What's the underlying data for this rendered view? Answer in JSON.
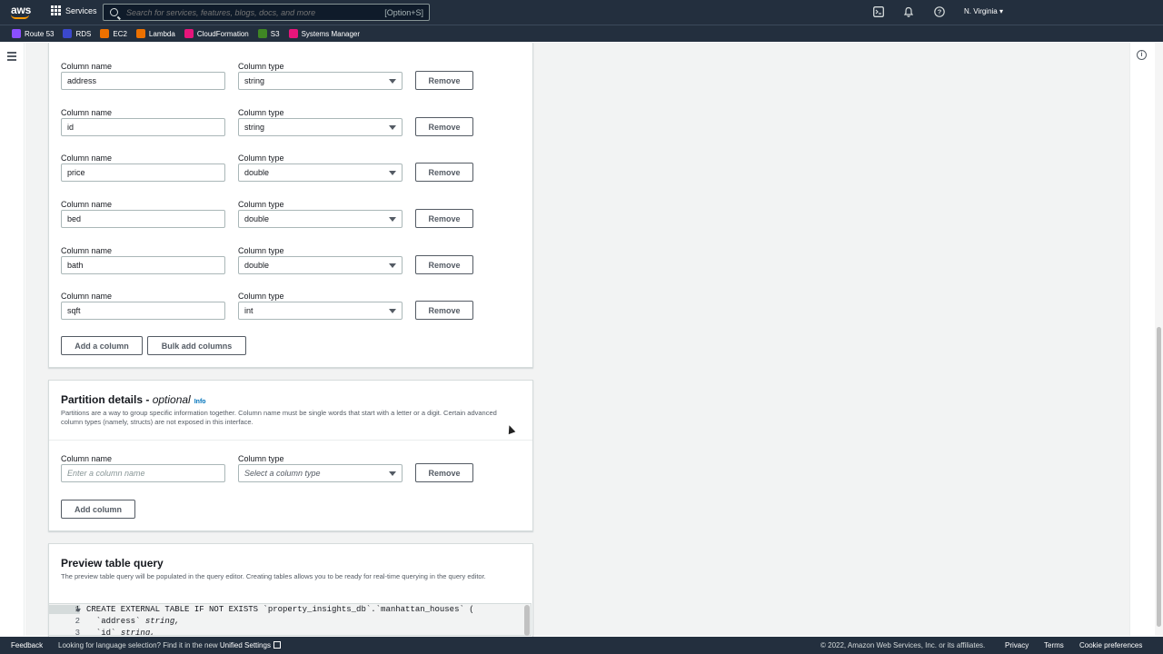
{
  "topnav": {
    "logo_text": "aws",
    "services_label": "Services",
    "search_placeholder": "Search for services, features, blogs, docs, and more",
    "search_shortcut": "[Option+S]",
    "region_label": "N. Virginia ▾"
  },
  "favorites": [
    {
      "label": "Route 53",
      "color": "#8c4fff"
    },
    {
      "label": "RDS",
      "color": "#3b48cc"
    },
    {
      "label": "EC2",
      "color": "#ed7100"
    },
    {
      "label": "Lambda",
      "color": "#ed7100"
    },
    {
      "label": "CloudFormation",
      "color": "#e7157b"
    },
    {
      "label": "S3",
      "color": "#3f8624"
    },
    {
      "label": "Systems Manager",
      "color": "#e7157b"
    }
  ],
  "columns": {
    "name_label": "Column name",
    "type_label": "Column type",
    "remove_label": "Remove",
    "rows": [
      {
        "name": "address",
        "type": "string"
      },
      {
        "name": "id",
        "type": "string"
      },
      {
        "name": "price",
        "type": "double"
      },
      {
        "name": "bed",
        "type": "double"
      },
      {
        "name": "bath",
        "type": "double"
      },
      {
        "name": "sqft",
        "type": "int"
      }
    ],
    "add_column_label": "Add a column",
    "bulk_add_label": "Bulk add columns"
  },
  "partition": {
    "title": "Partition details - ",
    "title_optional": "optional",
    "info_label": "Info",
    "description": "Partitions are a way to group specific information together. Column name must be single words that start with a letter or a digit. Certain advanced column types (namely, structs) are not exposed in this interface.",
    "name_label": "Column name",
    "type_label": "Column type",
    "name_placeholder": "Enter a column name",
    "type_placeholder": "Select a column type",
    "remove_label": "Remove",
    "add_column_label": "Add column"
  },
  "preview": {
    "title": "Preview table query",
    "description": "The preview table query will be populated in the query editor. Creating tables allows you to be ready for real-time querying in the query editor.",
    "code_lines": [
      {
        "n": "1",
        "text": "CREATE EXTERNAL TABLE IF NOT EXISTS `property_insights_db`.`manhattan_houses` ("
      },
      {
        "n": "2",
        "col": "  `address`",
        "type": "string,"
      },
      {
        "n": "3",
        "col": "  `id`",
        "type": "string,"
      }
    ]
  },
  "footer": {
    "feedback": "Feedback",
    "language_text": "Looking for language selection? Find it in the new ",
    "language_link": "Unified Settings",
    "copyright": "© 2022, Amazon Web Services, Inc. or its affiliates.",
    "privacy": "Privacy",
    "terms": "Terms",
    "cookie": "Cookie preferences"
  }
}
